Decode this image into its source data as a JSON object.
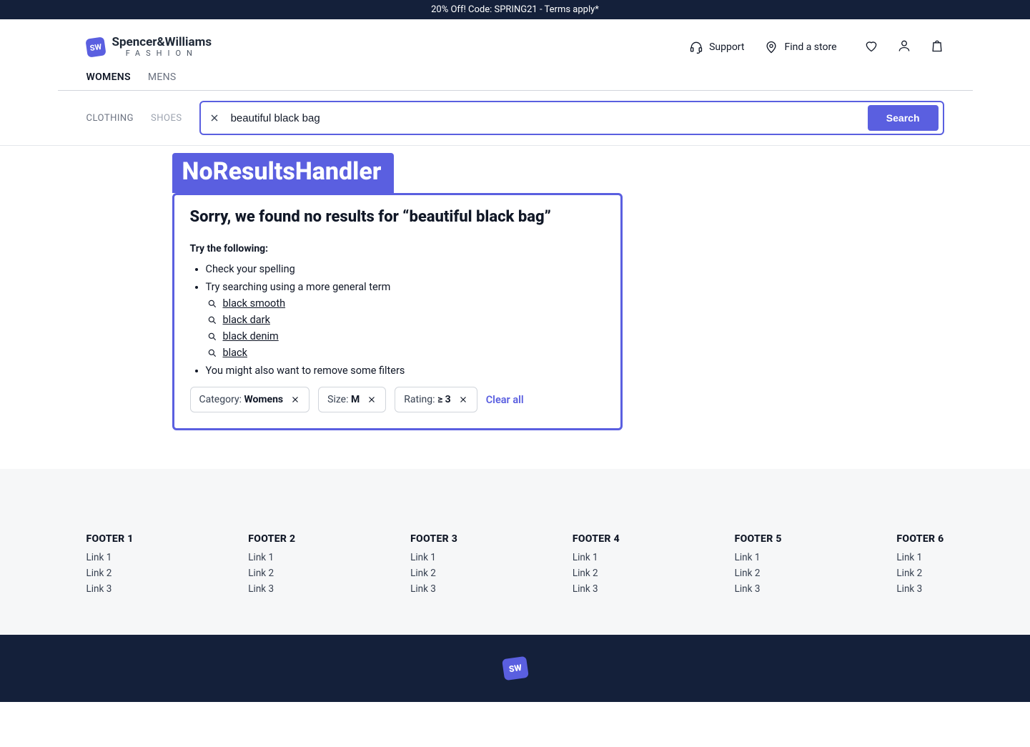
{
  "promo": {
    "text": "20% Off! Code: SPRING21 - Terms apply*"
  },
  "brand": {
    "badge": "SW",
    "line1": "Spencer&Williams",
    "line2": "FASHION"
  },
  "header": {
    "support": "Support",
    "find_store": "Find a store"
  },
  "gender_tabs": {
    "womens": "WOMENS",
    "mens": "MENS"
  },
  "categories": {
    "clothing": "CLOTHING",
    "shoes": "SHOES"
  },
  "search": {
    "value": "beautiful black bag",
    "button": "Search"
  },
  "widget": {
    "name": "NoResultsHandler",
    "heading_prefix": "Sorry, we found no results for “",
    "heading_query": "beautiful black bag",
    "heading_suffix": "”",
    "try_label": "Try the following:",
    "tips": {
      "spelling": "Check your spelling",
      "general": "Try searching using a more general term",
      "remove_filters": "You might also want to remove some filters"
    },
    "suggestions": [
      "black smooth",
      "black dark",
      "black denim",
      "black"
    ],
    "filters": [
      {
        "label": "Category:",
        "value": "Womens"
      },
      {
        "label": "Size:",
        "value": "M"
      },
      {
        "label": "Rating:",
        "value": "≥ 3"
      }
    ],
    "clear_all": "Clear all"
  },
  "footer": {
    "columns": [
      {
        "title": "FOOTER 1",
        "links": [
          "Link 1",
          "Link 2",
          "Link 3"
        ]
      },
      {
        "title": "FOOTER 2",
        "links": [
          "Link 1",
          "Link 2",
          "Link 3"
        ]
      },
      {
        "title": "FOOTER 3",
        "links": [
          "Link 1",
          "Link 2",
          "Link 3"
        ]
      },
      {
        "title": "FOOTER 4",
        "links": [
          "Link 1",
          "Link 2",
          "Link 3"
        ]
      },
      {
        "title": "FOOTER 5",
        "links": [
          "Link 1",
          "Link 2",
          "Link 3"
        ]
      },
      {
        "title": "FOOTER 6",
        "links": [
          "Link 1",
          "Link 2",
          "Link 3"
        ]
      }
    ],
    "badge": "SW"
  }
}
